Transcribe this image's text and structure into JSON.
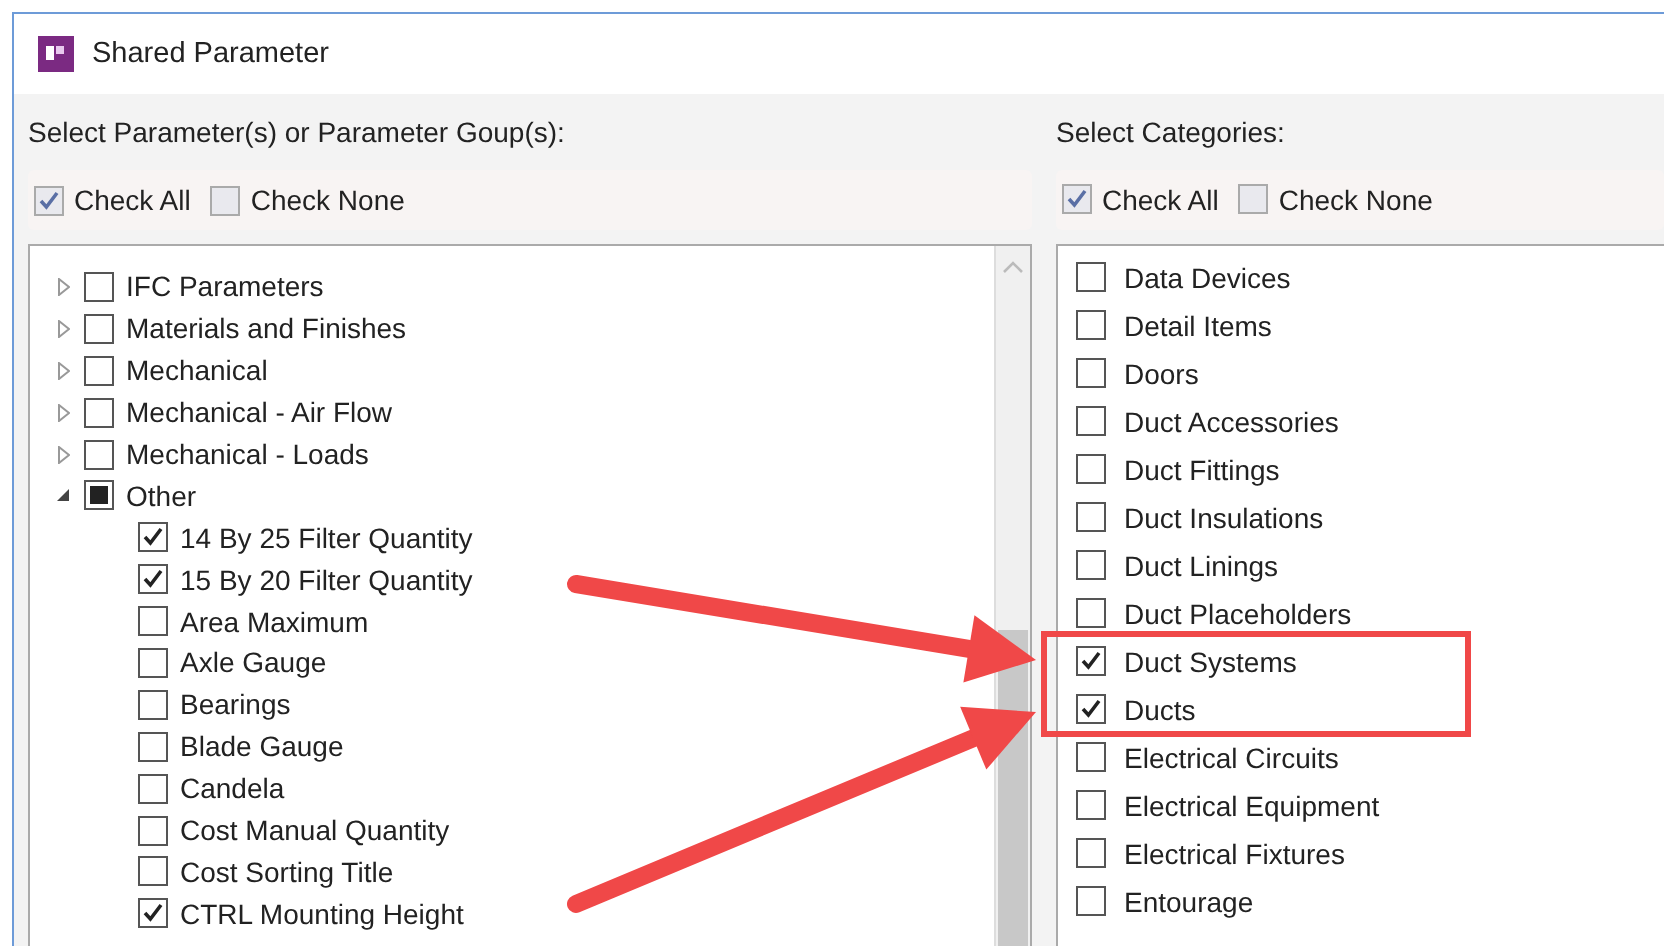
{
  "window": {
    "title": "Shared Parameter"
  },
  "parameters": {
    "label": "Select Parameter(s) or Parameter Goup(s):",
    "check_all": {
      "label": "Check All",
      "checked": true
    },
    "check_none": {
      "label": "Check None",
      "checked": false
    },
    "tree": [
      {
        "label": "IFC Parameters",
        "expanded": false,
        "checked": false,
        "partial": false
      },
      {
        "label": "Materials and Finishes",
        "expanded": false,
        "checked": false,
        "partial": false
      },
      {
        "label": "Mechanical",
        "expanded": false,
        "checked": false,
        "partial": false
      },
      {
        "label": "Mechanical - Air Flow",
        "expanded": false,
        "checked": false,
        "partial": false
      },
      {
        "label": "Mechanical - Loads",
        "expanded": false,
        "checked": false,
        "partial": false
      },
      {
        "label": "Other",
        "expanded": true,
        "checked": false,
        "partial": true,
        "children": [
          {
            "label": "14 By 25 Filter Quantity",
            "checked": true
          },
          {
            "label": "15 By 20 Filter Quantity",
            "checked": true
          },
          {
            "label": "Area Maximum",
            "checked": false
          },
          {
            "label": "Axle Gauge",
            "checked": false
          },
          {
            "label": "Bearings",
            "checked": false
          },
          {
            "label": "Blade Gauge",
            "checked": false
          },
          {
            "label": "Candela",
            "checked": false
          },
          {
            "label": "Cost Manual Quantity",
            "checked": false
          },
          {
            "label": "Cost Sorting Title",
            "checked": false
          },
          {
            "label": "CTRL Mounting Height",
            "checked": true
          }
        ]
      }
    ]
  },
  "categories": {
    "label": "Select Categories:",
    "check_all": {
      "label": "Check All",
      "checked": true
    },
    "check_none": {
      "label": "Check None",
      "checked": false
    },
    "items": [
      {
        "label": "Data Devices",
        "checked": false
      },
      {
        "label": "Detail Items",
        "checked": false
      },
      {
        "label": "Doors",
        "checked": false
      },
      {
        "label": "Duct Accessories",
        "checked": false
      },
      {
        "label": "Duct Fittings",
        "checked": false
      },
      {
        "label": "Duct Insulations",
        "checked": false
      },
      {
        "label": "Duct Linings",
        "checked": false
      },
      {
        "label": "Duct Placeholders",
        "checked": false
      },
      {
        "label": "Duct Systems",
        "checked": true
      },
      {
        "label": "Ducts",
        "checked": true
      },
      {
        "label": "Electrical Circuits",
        "checked": false
      },
      {
        "label": "Electrical Equipment",
        "checked": false
      },
      {
        "label": "Electrical Fixtures",
        "checked": false
      },
      {
        "label": "Entourage",
        "checked": false
      }
    ]
  },
  "annotations": [
    {
      "kind": "arrow",
      "color": "#f04848"
    },
    {
      "kind": "arrow",
      "color": "#f04848"
    },
    {
      "kind": "box",
      "color": "#f04848"
    }
  ]
}
